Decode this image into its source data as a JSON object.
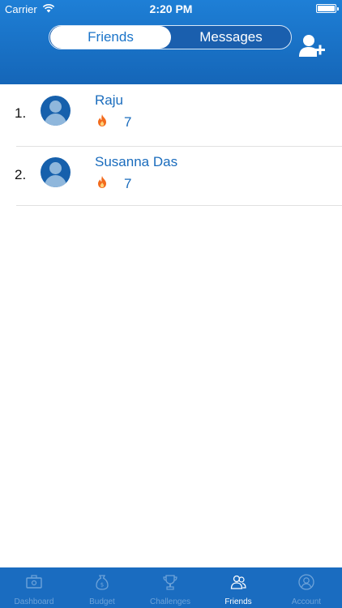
{
  "status_bar": {
    "carrier": "Carrier",
    "time": "2:20 PM"
  },
  "segmented_control": {
    "friends_label": "Friends",
    "messages_label": "Messages",
    "selected": "Friends"
  },
  "friends": [
    {
      "rank": "1.",
      "name": "Raju",
      "score": "7"
    },
    {
      "rank": "2.",
      "name": "Susanna Das",
      "score": "7"
    }
  ],
  "tab_bar": {
    "items": [
      {
        "label": "Dashboard",
        "icon": "dashboard-icon"
      },
      {
        "label": "Budget",
        "icon": "budget-icon"
      },
      {
        "label": "Challenges",
        "icon": "trophy-icon"
      },
      {
        "label": "Friends",
        "icon": "friends-icon"
      },
      {
        "label": "Account",
        "icon": "account-icon"
      }
    ],
    "active": "Friends"
  },
  "colors": {
    "header": "#1a74c9",
    "tab_bar": "#1a6cc0",
    "accent_text": "#1a6cbd",
    "fire": "#f26b1d"
  }
}
